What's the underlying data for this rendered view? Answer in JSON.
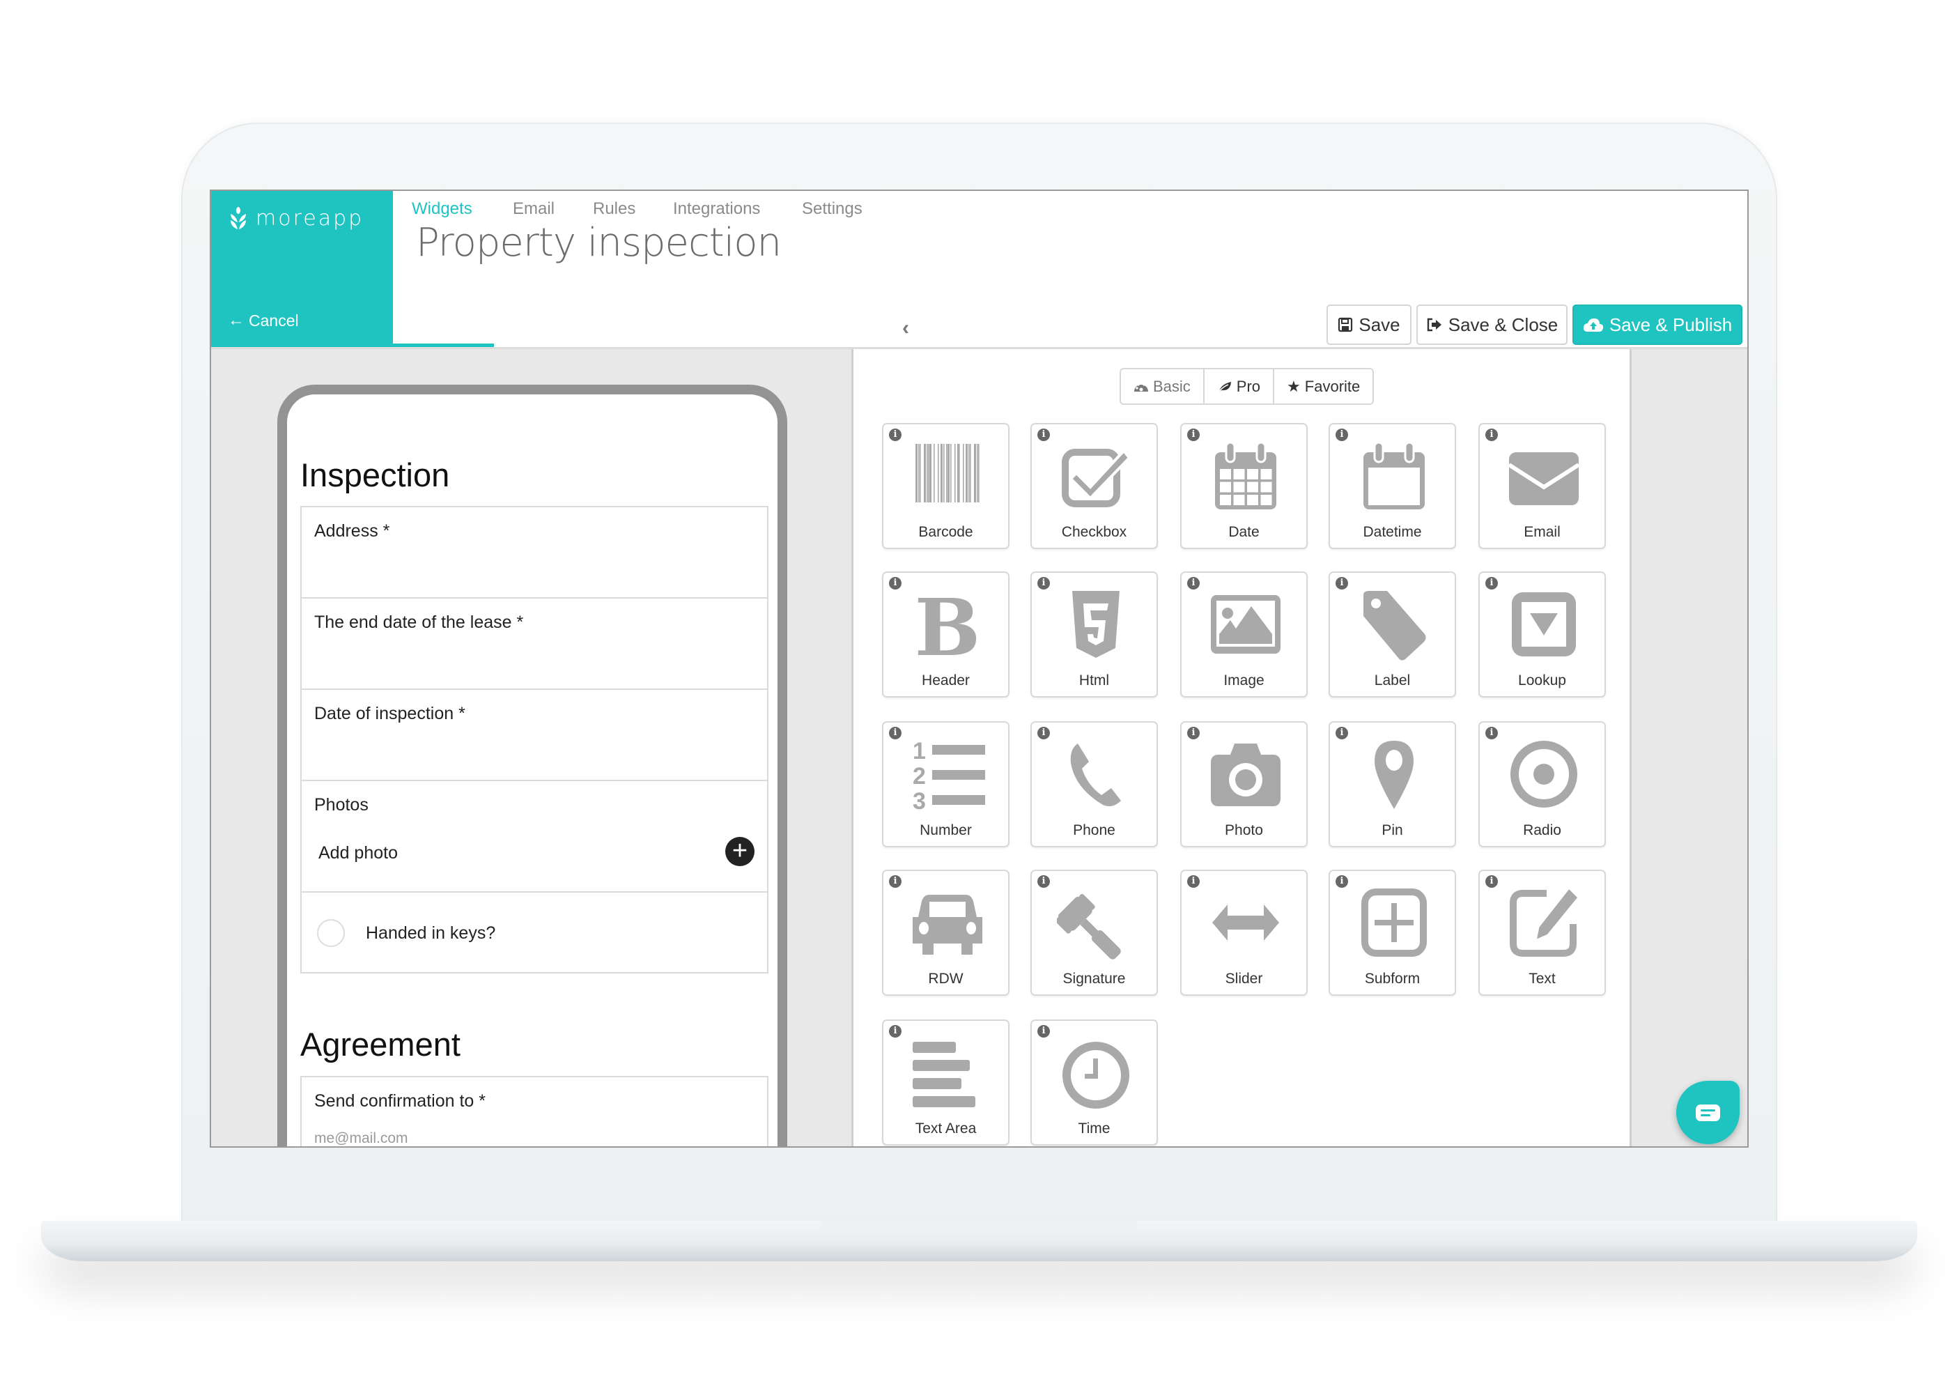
{
  "brand": {
    "name": "moreapp",
    "color": "#1fc3c0"
  },
  "header": {
    "cancel_label": "Cancel",
    "title": "Property inspection",
    "tabs": [
      {
        "label": "Widgets",
        "active": true
      },
      {
        "label": "Email",
        "active": false
      },
      {
        "label": "Rules",
        "active": false
      },
      {
        "label": "Integrations",
        "active": false
      },
      {
        "label": "Settings",
        "active": false
      }
    ],
    "collapse_icon": "chevron-left-icon",
    "buttons": {
      "save": {
        "label": "Save",
        "icon": "floppy-icon"
      },
      "save_close": {
        "label": "Save & Close",
        "icon": "sign-out-icon"
      },
      "save_publish": {
        "label": "Save & Publish",
        "icon": "cloud-upload-icon"
      }
    }
  },
  "form_preview": {
    "sections": [
      {
        "title": "Inspection",
        "fields": [
          {
            "label": "Address *"
          },
          {
            "label": "The end date of the lease *"
          },
          {
            "label": "Date of inspection *"
          },
          {
            "label": "Photos",
            "action_label": "Add photo"
          },
          {
            "label": "Handed in keys?",
            "type": "checkbox"
          }
        ]
      },
      {
        "title": "Agreement",
        "fields": [
          {
            "label": "Send confirmation to *",
            "placeholder": "me@mail.com"
          }
        ]
      }
    ]
  },
  "widget_panel": {
    "filters": [
      {
        "label": "Basic",
        "icon": "dashboard-icon"
      },
      {
        "label": "Pro",
        "icon": "leaf-icon"
      },
      {
        "label": "Favorite",
        "icon": "star-icon"
      }
    ],
    "widgets": [
      {
        "label": "Barcode",
        "icon": "barcode-icon"
      },
      {
        "label": "Checkbox",
        "icon": "checkbox-icon"
      },
      {
        "label": "Date",
        "icon": "calendar-icon"
      },
      {
        "label": "Datetime",
        "icon": "calendar-blank-icon"
      },
      {
        "label": "Email",
        "icon": "envelope-icon"
      },
      {
        "label": "Header",
        "icon": "bold-icon"
      },
      {
        "label": "Html",
        "icon": "html5-icon"
      },
      {
        "label": "Image",
        "icon": "picture-icon"
      },
      {
        "label": "Label",
        "icon": "tag-icon"
      },
      {
        "label": "Lookup",
        "icon": "dropdown-icon"
      },
      {
        "label": "Number",
        "icon": "ordered-list-icon"
      },
      {
        "label": "Phone",
        "icon": "phone-icon"
      },
      {
        "label": "Photo",
        "icon": "camera-icon"
      },
      {
        "label": "Pin",
        "icon": "map-marker-icon"
      },
      {
        "label": "Radio",
        "icon": "radio-icon"
      },
      {
        "label": "RDW",
        "icon": "car-icon"
      },
      {
        "label": "Signature",
        "icon": "gavel-icon"
      },
      {
        "label": "Slider",
        "icon": "arrows-h-icon"
      },
      {
        "label": "Subform",
        "icon": "plus-square-icon"
      },
      {
        "label": "Text",
        "icon": "edit-icon"
      },
      {
        "label": "Text Area",
        "icon": "align-left-icon"
      },
      {
        "label": "Time",
        "icon": "clock-icon"
      }
    ],
    "info_icon": "info-icon"
  },
  "chat": {
    "icon": "chat-icon"
  }
}
